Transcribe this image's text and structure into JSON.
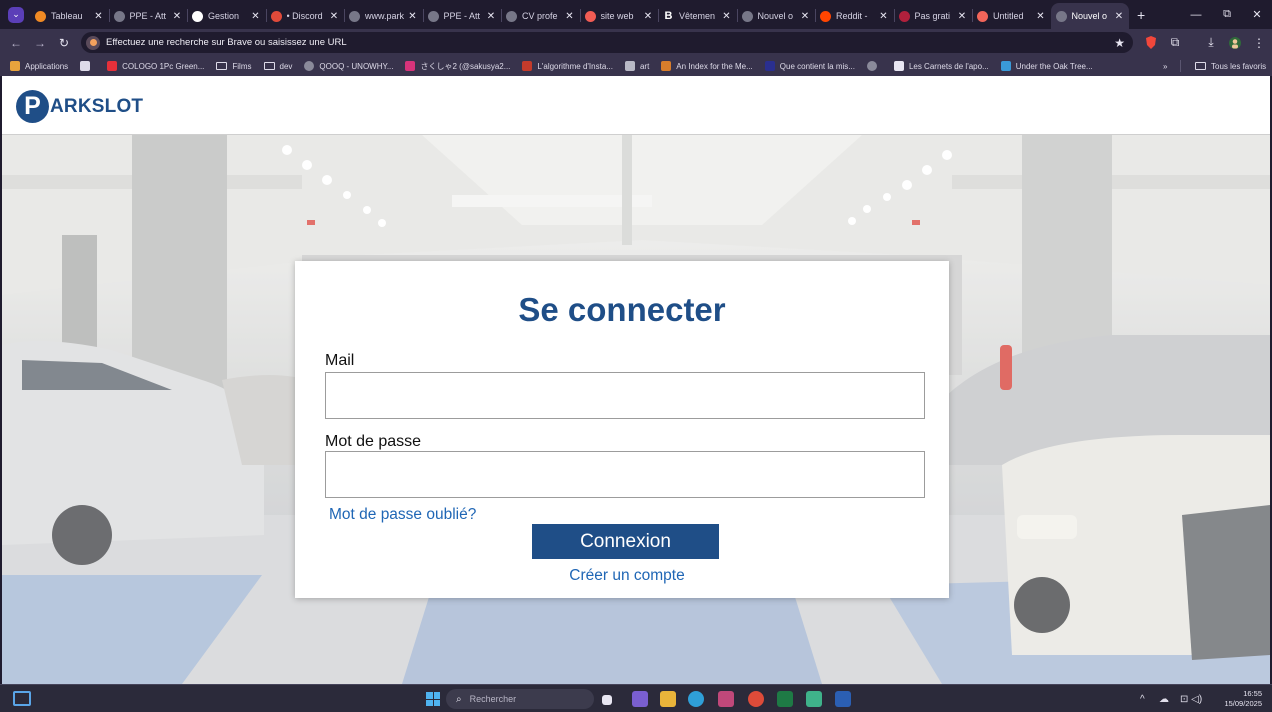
{
  "browser": {
    "tabs": [
      {
        "label": "Tableau",
        "icon": "hive-icon",
        "color": "#f08a24",
        "glyph": "in"
      },
      {
        "label": "PPE - Att",
        "icon": "globe-icon",
        "color": "#777788",
        "glyph": "◎"
      },
      {
        "label": "Gestion",
        "icon": "github-icon",
        "color": "#ffffff",
        "glyph": "◉"
      },
      {
        "label": "• Discord",
        "icon": "chrome-icon",
        "color": "#e04a3a",
        "glyph": "◕"
      },
      {
        "label": "www.park",
        "icon": "globe-icon",
        "color": "#777788",
        "glyph": "◎"
      },
      {
        "label": "PPE - Att",
        "icon": "globe-icon",
        "color": "#777788",
        "glyph": "◎"
      },
      {
        "label": "CV profe",
        "icon": "globe-icon",
        "color": "#777788",
        "glyph": "◎"
      },
      {
        "label": "site web",
        "icon": "brave-icon",
        "color": "#f25c54",
        "glyph": "◈"
      },
      {
        "label": "Vêtemen",
        "icon": "bold-b-icon",
        "color": "#1f1b2e",
        "glyph": "B"
      },
      {
        "label": "Nouvel o",
        "icon": "globe-icon",
        "color": "#777788",
        "glyph": "◎"
      },
      {
        "label": "Reddit -",
        "icon": "reddit-icon",
        "color": "#ff4500",
        "glyph": "●"
      },
      {
        "label": "Pas grati",
        "icon": "pinterest-icon",
        "color": "#b0203c",
        "glyph": "✿"
      },
      {
        "label": "Untitled",
        "icon": "figma-icon",
        "color": "#f2655a",
        "glyph": "▮"
      },
      {
        "label": "Nouvel o",
        "icon": "globe-icon",
        "color": "#777788",
        "glyph": "◎",
        "active": true
      }
    ],
    "address": "Effectuez une recherche sur Brave ou saisissez une URL",
    "bookmarks": [
      {
        "label": "Applications",
        "icon": "apps-grid-icon",
        "color": "#e8a33d"
      },
      {
        "label": "",
        "icon": "tab-groups-icon",
        "color": "#dedbe9"
      },
      {
        "label": "COLOGO 1Pc Green...",
        "icon": "aliexpress-icon",
        "color": "#e5303a"
      },
      {
        "label": "Films",
        "icon": "folder-icon",
        "folder": true
      },
      {
        "label": "dev",
        "icon": "folder-icon",
        "folder": true
      },
      {
        "label": "QOOQ - UNOWHY...",
        "icon": "globe-icon",
        "color": "#8a8a9a"
      },
      {
        "label": "さくしゃ2 (@sakusya2...",
        "icon": "instagram-icon",
        "color": "#d6337a"
      },
      {
        "label": "L'algorithme d'Insta...",
        "icon": "site-icon",
        "color": "#c43b2b"
      },
      {
        "label": "art",
        "icon": "image-icon",
        "color": "#b9b9c6"
      },
      {
        "label": "An Index for the Me...",
        "icon": "index-icon",
        "color": "#d87d2b"
      },
      {
        "label": "Que contient la mis...",
        "icon": "site-icon",
        "color": "#2a2f8f"
      },
      {
        "label": "",
        "icon": "globe-icon",
        "color": "#8a8a9a"
      },
      {
        "label": "Les Carnets de l'apo...",
        "icon": "wordpress-icon",
        "color": "#e8e6f2"
      },
      {
        "label": "Under the Oak Tree...",
        "icon": "site-icon",
        "color": "#3a9ad9"
      }
    ],
    "all_bookmarks": "Tous les favoris"
  },
  "site": {
    "logo_letter": "P",
    "logo_text": "ARKSLOT",
    "login": {
      "title": "Se connecter",
      "mail_label": "Mail",
      "mail_value": "",
      "password_label": "Mot de passe",
      "password_value": "",
      "forgot": "Mot de passe oublié?",
      "submit": "Connexion",
      "create": "Créer un compte"
    }
  },
  "taskbar": {
    "search_placeholder": "Rechercher",
    "time": "16:55",
    "date": "15/09/2025"
  },
  "colors": {
    "brand_blue": "#1f4e87",
    "link_blue": "#1f66b5",
    "browser_dark": "#1f1b2e",
    "browser_toolbar": "#38334c"
  }
}
